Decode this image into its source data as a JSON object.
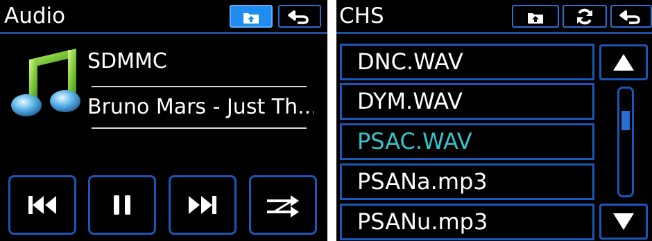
{
  "audio": {
    "title": "Audio",
    "header_buttons": [
      {
        "icon": "folder-up-icon",
        "active": true
      },
      {
        "icon": "back-arrow-icon",
        "active": false
      }
    ],
    "album_icon": "music-note-icon",
    "source": "SDMMC",
    "track": "Bruno Mars - Just Th...",
    "controls": [
      "previous-track-icon",
      "pause-icon",
      "next-track-icon",
      "shuffle-icon"
    ],
    "colors": {
      "accent": "#1c56b8",
      "active_button": "#1f8cf0"
    }
  },
  "browser": {
    "title": "CHS",
    "header_buttons": [
      {
        "icon": "folder-up-icon"
      },
      {
        "icon": "refresh-icon"
      },
      {
        "icon": "back-arrow-icon"
      }
    ],
    "files": [
      {
        "name": "DNC.WAV",
        "selected": false
      },
      {
        "name": "DYM.WAV",
        "selected": false
      },
      {
        "name": "PSAC.WAV",
        "selected": true
      },
      {
        "name": "PSANa.mp3",
        "selected": false
      },
      {
        "name": "PSANu.mp3",
        "selected": false
      }
    ],
    "scroll_position": 0.25,
    "colors": {
      "selected_text": "#35c3c8",
      "border": "#1c56b8"
    }
  }
}
